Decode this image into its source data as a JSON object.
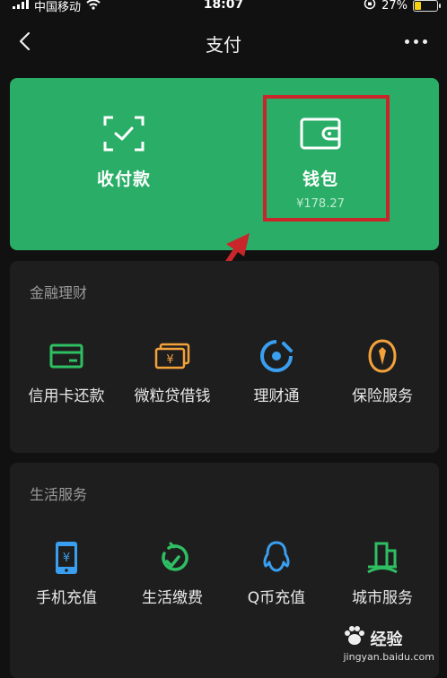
{
  "status_bar": {
    "carrier": "中国移动",
    "time": "18:07",
    "battery": "27%"
  },
  "nav": {
    "title": "支付"
  },
  "pay_card": {
    "receive_label": "收付款",
    "wallet_label": "钱包",
    "wallet_amount": "¥178.27"
  },
  "finance": {
    "title": "金融理财",
    "items": [
      {
        "label": "信用卡还款",
        "icon": "credit-card-icon"
      },
      {
        "label": "微粒贷借钱",
        "icon": "loan-icon"
      },
      {
        "label": "理财通",
        "icon": "wealth-icon"
      },
      {
        "label": "保险服务",
        "icon": "insurance-icon"
      }
    ]
  },
  "life": {
    "title": "生活服务",
    "items": [
      {
        "label": "手机充值",
        "icon": "phone-topup-icon"
      },
      {
        "label": "生活缴费",
        "icon": "utility-payment-icon"
      },
      {
        "label": "Q币充值",
        "icon": "qq-coin-icon"
      },
      {
        "label": "城市服务",
        "icon": "city-service-icon"
      }
    ]
  },
  "watermark": {
    "brand": "经验",
    "url": "jingyan.baidu.com"
  },
  "colors": {
    "green": "#2aae67",
    "highlight": "#c8262a",
    "finance_green": "#2fbf63",
    "orange": "#f3a23a",
    "blue": "#3a9ff0"
  }
}
